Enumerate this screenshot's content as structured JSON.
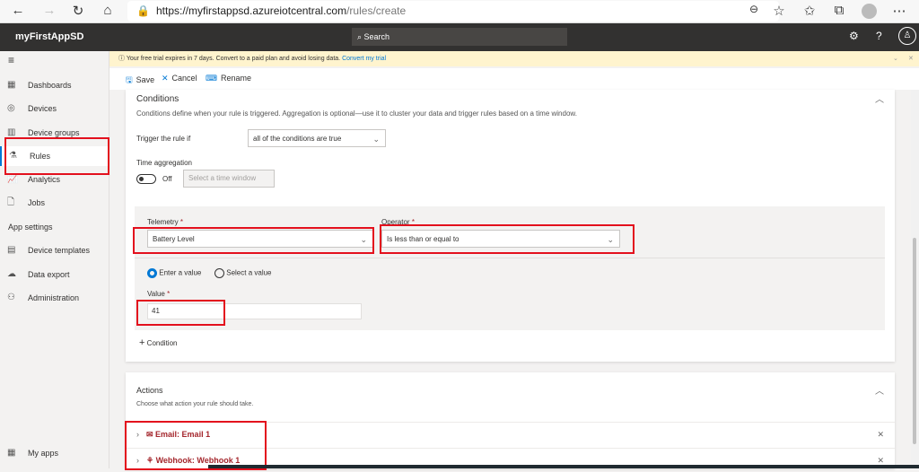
{
  "browser": {
    "url_host": "https://myfirstappsd.azureiotcentral.com",
    "url_path": "/rules/create"
  },
  "app": {
    "name": "myFirstAppSD",
    "search_placeholder": "Search"
  },
  "sidebar": {
    "items": [
      {
        "label": "Dashboards"
      },
      {
        "label": "Devices"
      },
      {
        "label": "Device groups"
      },
      {
        "label": "Rules"
      },
      {
        "label": "Analytics"
      },
      {
        "label": "Jobs"
      }
    ],
    "section": "App settings",
    "settings": [
      {
        "label": "Device templates"
      },
      {
        "label": "Data export"
      },
      {
        "label": "Administration"
      }
    ],
    "bottom": "My apps"
  },
  "banner": {
    "text": "Your free trial expires in 7 days. Convert to a paid plan and avoid losing data.",
    "link": "Convert my trial"
  },
  "toolbar": {
    "save": "Save",
    "cancel": "Cancel",
    "rename": "Rename"
  },
  "conditions": {
    "title": "Conditions",
    "description": "Conditions define when your rule is triggered. Aggregation is optional—use it to cluster your data and trigger rules based on a time window.",
    "trigger_label": "Trigger the rule if",
    "trigger_value": "all of the conditions are true",
    "time_agg_label": "Time aggregation",
    "toggle_state": "Off",
    "time_window_placeholder": "Select a time window",
    "telemetry_label": "Telemetry",
    "telemetry_value": "Battery Level",
    "operator_label": "Operator",
    "operator_value": "Is less than or equal to",
    "radio_enter": "Enter a value",
    "radio_select": "Select a value",
    "value_label": "Value",
    "value": "41",
    "add_condition": "Condition",
    "required": "*"
  },
  "actions": {
    "title": "Actions",
    "description": "Choose what action your rule should take.",
    "items": [
      {
        "label": "Email: Email 1"
      },
      {
        "label": "Webhook: Webhook 1"
      }
    ]
  }
}
